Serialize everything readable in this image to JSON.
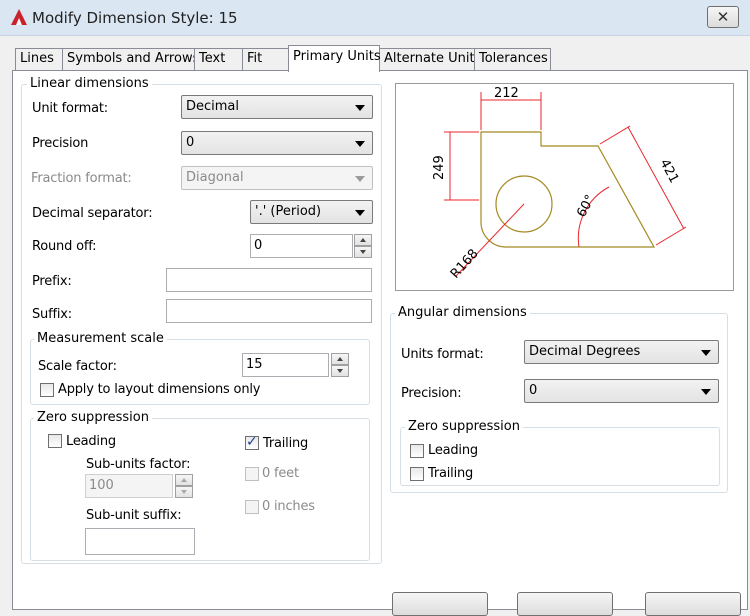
{
  "window": {
    "title": "Modify Dimension Style: 15",
    "close_glyph": "✕"
  },
  "tabs": [
    {
      "label": "Lines"
    },
    {
      "label": "Symbols and Arrows"
    },
    {
      "label": "Text"
    },
    {
      "label": "Fit"
    },
    {
      "label": "Primary Units",
      "active": true
    },
    {
      "label": "Alternate Units"
    },
    {
      "label": "Tolerances"
    }
  ],
  "linear": {
    "legend": "Linear dimensions",
    "unit_format_label": "Unit format:",
    "unit_format_value": "Decimal",
    "precision_label": "Precision",
    "precision_value": "0",
    "fraction_format_label": "Fraction format:",
    "fraction_format_value": "Diagonal",
    "decimal_sep_label": "Decimal separator:",
    "decimal_sep_value": "'.' (Period)",
    "round_off_label": "Round off:",
    "round_off_value": "0",
    "prefix_label": "Prefix:",
    "prefix_value": "",
    "suffix_label": "Suffix:",
    "suffix_value": ""
  },
  "measurement": {
    "legend": "Measurement scale",
    "scale_label": "Scale factor:",
    "scale_value": "15",
    "apply_label": "Apply to layout dimensions only",
    "apply_checked": false
  },
  "zero": {
    "legend": "Zero suppression",
    "leading_label": "Leading",
    "leading_checked": false,
    "trailing_label": "Trailing",
    "trailing_checked": true,
    "subunits_factor_label": "Sub-units factor:",
    "subunits_factor_value": "100",
    "subunit_suffix_label": "Sub-unit suffix:",
    "subunit_suffix_value": "",
    "zero_feet_label": "0 feet",
    "zero_inches_label": "0 inches"
  },
  "angular": {
    "legend": "Angular dimensions",
    "units_label": "Units format:",
    "units_value": "Decimal Degrees",
    "precision_label": "Precision:",
    "precision_value": "0",
    "zero_legend": "Zero suppression",
    "leading_label": "Leading",
    "trailing_label": "Trailing"
  },
  "preview": {
    "dim_width": "212",
    "dim_height": "249",
    "dim_diagonal": "421",
    "dim_angle": "60°",
    "dim_radius": "R168",
    "shape_color": "#a58a22",
    "dim_color": "#e8262b"
  },
  "check_glyph": "✓"
}
